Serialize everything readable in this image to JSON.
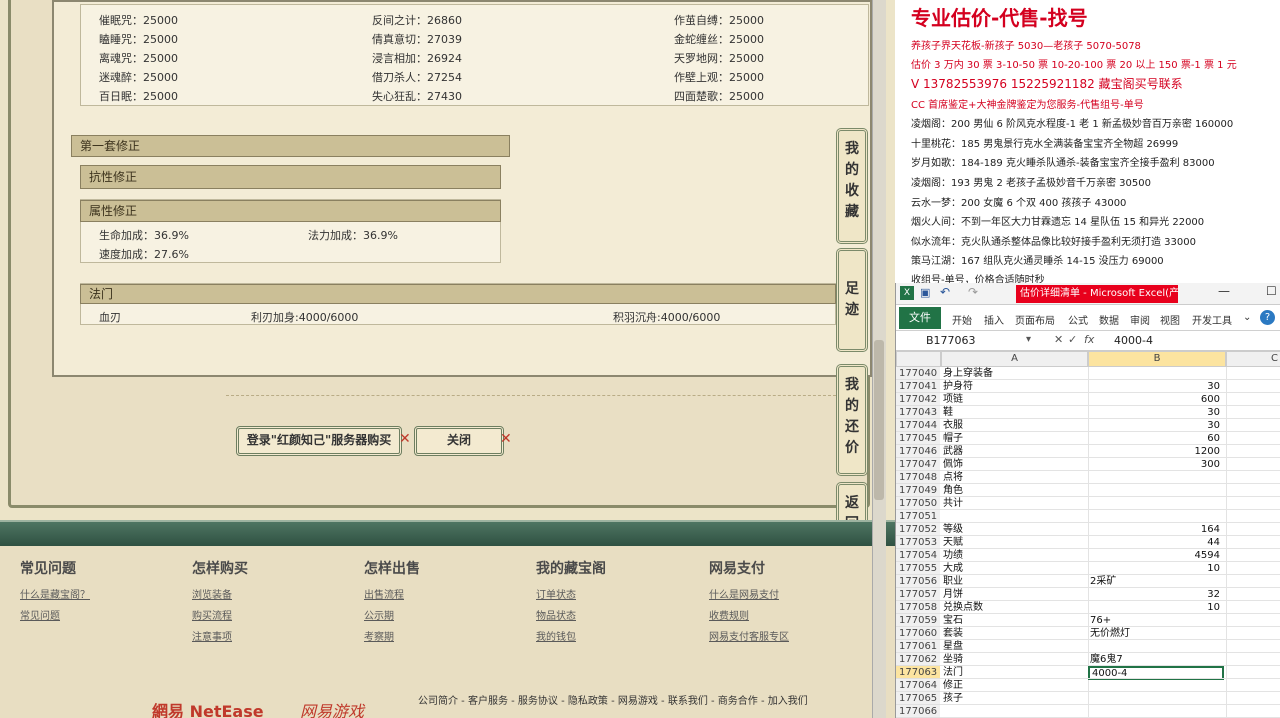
{
  "spells": [
    [
      "催眠咒：25000",
      "反间之计：26860",
      "作茧自缚：25000"
    ],
    [
      "瞌睡咒：25000",
      "倩真意切：27039",
      "金蛇缠丝：25000"
    ],
    [
      "离魂咒：25000",
      "浸言相加：26924",
      "天罗地网：25000"
    ],
    [
      "迷魂醉：25000",
      "借刀杀人：27254",
      "作壁上观：25000"
    ],
    [
      "百日眠：25000",
      "失心狂乱：27430",
      "四面楚歌：25000"
    ]
  ],
  "section1": "第一套修正",
  "resist": "抗性修正",
  "attr_title": "属性修正",
  "attrs": {
    "a1": "生命加成：36.9%",
    "a2": "法力加成：36.9%",
    "a3": "速度加成：27.6%"
  },
  "fa_title": "法门",
  "fa": {
    "f1": "血刃",
    "f2": "利刃加身:4000/6000",
    "f3": "积羽沉舟:4000/6000"
  },
  "buttons": {
    "login": "登录\"红颜知己\"服务器购买",
    "close": "关闭"
  },
  "side_tabs": [
    "我的收藏",
    "足迹",
    "我的还价",
    "返回顶部"
  ],
  "footer_cols": [
    {
      "title": "常见问题",
      "links": [
        "什么是藏宝阁？",
        "常见问题"
      ]
    },
    {
      "title": "怎样购买",
      "links": [
        "浏览装备",
        "购买流程",
        "注意事项"
      ]
    },
    {
      "title": "怎样出售",
      "links": [
        "出售流程",
        "公示期",
        "考察期"
      ]
    },
    {
      "title": "我的藏宝阁",
      "links": [
        "订单状态",
        "物品状态",
        "我的钱包"
      ]
    },
    {
      "title": "网易支付",
      "links": [
        "什么是网易支付",
        "收费规则",
        "网易支付客服专区"
      ]
    }
  ],
  "footer_links": "公司简介 - 客户服务 - 服务协议 - 隐私政策 - 网易游戏 - 联系我们 - 商务合作 - 加入我们",
  "logos": {
    "netease": "網易 NetEase",
    "game": "网易游戏"
  },
  "ad": {
    "title": "专业估价-代售-找号",
    "lines": [
      {
        "t": "养孩子界天花板-新孩子 5030—老孩子 5070-5078",
        "c": "red"
      },
      {
        "t": "估价 3 万内 30 票 3-10-50 票 10-20-100 票 20 以上 150 票-1 票 1 元",
        "c": "red"
      },
      {
        "t": "V 13782553976   15225921182  藏宝阁买号联系",
        "c": "red"
      },
      {
        "t": "CC 首席鉴定+大神金牌鉴定为您服务-代售组号-单号",
        "c": "red"
      },
      {
        "t": "凌烟阁：200 男仙 6 阶风克水程度-1 老 1 新孟极妙音百万亲密 160000",
        "c": "black"
      },
      {
        "t": "十里桃花：185 男鬼景行克水全满装备宝宝齐全物超 26999",
        "c": "black"
      },
      {
        "t": "岁月如歌：184-189 克火睡杀队通杀-装备宝宝齐全接手盈利 83000",
        "c": "black"
      },
      {
        "t": "凌烟阁：193 男鬼 2 老孩子孟极妙音千万亲密 30500",
        "c": "black"
      },
      {
        "t": "云水一梦：200 女魔 6 个双 400 孩孩子 43000",
        "c": "black"
      },
      {
        "t": "烟火人间：不到一年区大力甘霖遗忘 14 星队伍 15 和异光 22000",
        "c": "black"
      },
      {
        "t": "似水流年：克火队通杀整体品像比较好接手盈利无须打造 33000",
        "c": "black"
      },
      {
        "t": "策马江湖：167 组队克火通灵睡杀 14-15 没压力 69000",
        "c": "black"
      },
      {
        "t": "收组号-单号，价格合适随时秒",
        "c": "black"
      }
    ]
  },
  "excel": {
    "title": "估价详细清单 - Microsoft Excel(产...",
    "file": "文件",
    "tabs": [
      "开始",
      "插入",
      "页面布局",
      "公式",
      "数据",
      "审阅",
      "视图",
      "开发工具"
    ],
    "namebox": "B177063",
    "formula": "4000-4",
    "cols": [
      "A",
      "B",
      "C"
    ],
    "rows": [
      [
        "177040",
        "身上穿装备",
        ""
      ],
      [
        "177041",
        "护身符",
        "30"
      ],
      [
        "177042",
        "项链",
        "600"
      ],
      [
        "177043",
        "鞋",
        "30"
      ],
      [
        "177044",
        "衣服",
        "30"
      ],
      [
        "177045",
        "帽子",
        "60"
      ],
      [
        "177046",
        "武器",
        "1200"
      ],
      [
        "177047",
        "佩饰",
        "300"
      ],
      [
        "177048",
        "点将",
        ""
      ],
      [
        "177049",
        "角色",
        ""
      ],
      [
        "177050",
        "共计",
        ""
      ],
      [
        "177051",
        "",
        ""
      ],
      [
        "177052",
        "等级",
        "164"
      ],
      [
        "177053",
        "天赋",
        "44"
      ],
      [
        "177054",
        "功绩",
        "4594"
      ],
      [
        "177055",
        "大成",
        "10"
      ],
      [
        "177056",
        "职业",
        "2采矿"
      ],
      [
        "177057",
        "月饼",
        "32"
      ],
      [
        "177058",
        "兑换点数",
        "10"
      ],
      [
        "177059",
        "宝石",
        "76+"
      ],
      [
        "177060",
        "套装",
        "无价燃灯"
      ],
      [
        "177061",
        "星盘",
        ""
      ],
      [
        "177062",
        "坐骑",
        "魔6鬼7"
      ],
      [
        "177063",
        "法门",
        "4000-4"
      ],
      [
        "177064",
        "修正",
        ""
      ],
      [
        "177065",
        "孩子",
        ""
      ],
      [
        "177066",
        "",
        ""
      ]
    ]
  }
}
